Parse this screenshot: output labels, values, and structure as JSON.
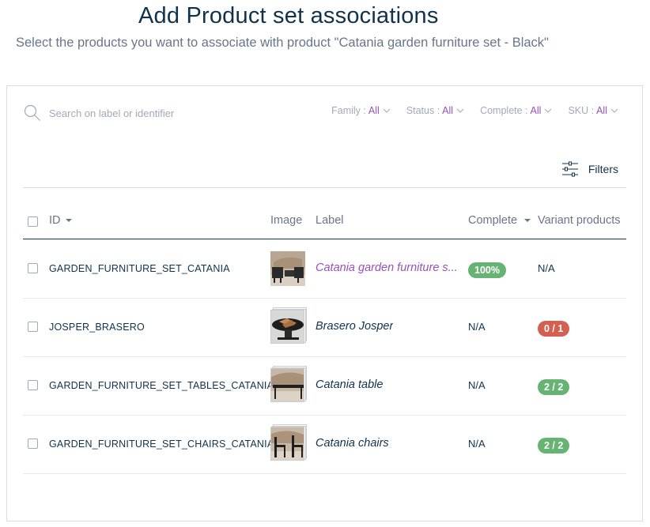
{
  "header": {
    "title": "Add Product set associations",
    "subtitle": "Select the products you want to associate with product \"Catania garden furniture set - Black\""
  },
  "search": {
    "placeholder": "Search on label or identifier",
    "icon": "search-icon"
  },
  "filters": [
    {
      "label": "Family",
      "value": "All"
    },
    {
      "label": "Status",
      "value": "All"
    },
    {
      "label": "Complete",
      "value": "All"
    },
    {
      "label": "SKU",
      "value": "All"
    }
  ],
  "filters_button": {
    "label": "Filters",
    "icon": "sliders-icon"
  },
  "table": {
    "columns": {
      "id": "ID",
      "image": "Image",
      "label": "Label",
      "complete": "Complete",
      "variant": "Variant products"
    },
    "rows": [
      {
        "id": "GARDEN_FURNITURE_SET_CATANIA",
        "label": "Catania garden furniture s...",
        "complete": "100%",
        "variant": "N/A"
      },
      {
        "id": "JOSPER_BRASERO",
        "label": "Brasero Josper",
        "complete": "N/A",
        "variant": "0 / 1"
      },
      {
        "id": "GARDEN_FURNITURE_SET_TABLES_CATANIA",
        "label": "Catania table",
        "complete": "N/A",
        "variant": "2 / 2"
      },
      {
        "id": "GARDEN_FURNITURE_SET_CHAIRS_CATANIA",
        "label": "Catania chairs",
        "complete": "N/A",
        "variant": "2 / 2"
      }
    ]
  },
  "colors": {
    "primary_text": "#11324d",
    "muted_text": "#67768a",
    "accent_purple": "#9452ba",
    "badge_green": "#67b373",
    "badge_red": "#d4604f"
  }
}
